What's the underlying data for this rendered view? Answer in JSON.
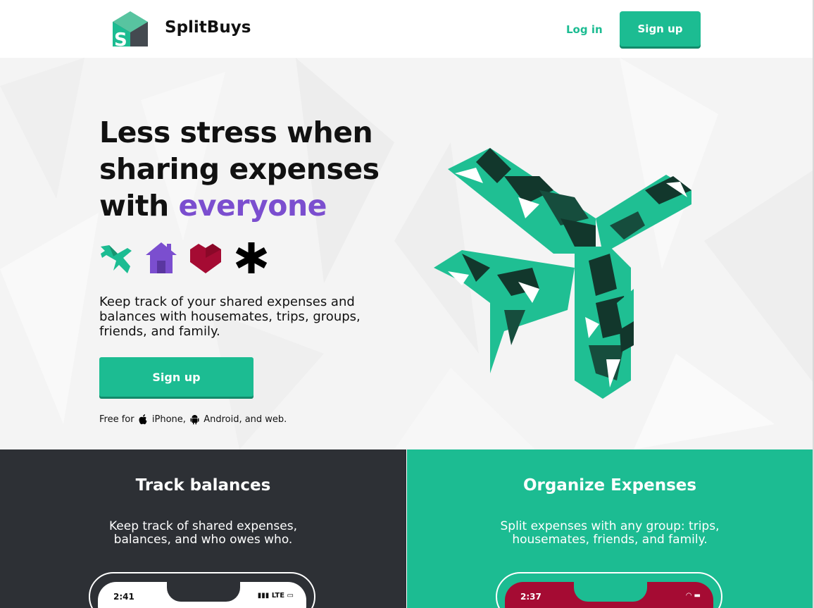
{
  "header": {
    "brand": "SplitBuys",
    "login_label": "Log in",
    "signup_label": "Sign up"
  },
  "hero": {
    "headline_part1": "Less stress when sharing expenses with ",
    "headline_accent": "everyone",
    "category_icons": [
      "airplane-icon",
      "house-icon",
      "heart-icon",
      "asterisk-icon"
    ],
    "description": "Keep track of your shared expenses and balances with housemates, trips, groups, friends, and family.",
    "signup_label": "Sign up",
    "platforms": {
      "prefix": "Free for",
      "iphone": "iPhone,",
      "android": "Android, and web."
    }
  },
  "features": [
    {
      "title": "Track balances",
      "description": "Keep track of shared expenses, balances, and who owes who.",
      "phone_time": "2:41",
      "phone_status": "LTE"
    },
    {
      "title": "Organize Expenses",
      "description": "Split expenses with any group: trips, housemates, friends, and family.",
      "phone_time": "2:37"
    }
  ],
  "colors": {
    "accent_green": "#1cbc92",
    "accent_purple": "#7b4ecf",
    "heart_red": "#a50b33",
    "dark_panel": "#2d3035",
    "plane_dark": "#12372c"
  }
}
